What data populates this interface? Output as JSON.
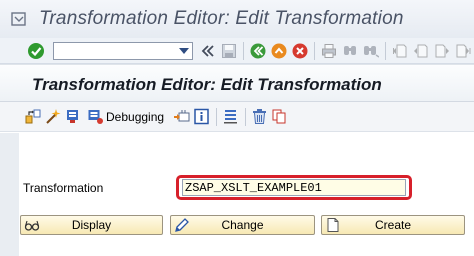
{
  "window": {
    "title": "Transformation Editor: Edit Transformation"
  },
  "toolbar": {
    "command_field_value": ""
  },
  "page": {
    "title": "Transformation Editor: Edit Transformation"
  },
  "app_toolbar": {
    "debugging_label": "Debugging"
  },
  "form": {
    "transformation_label": "Transformation",
    "transformation_value": "ZSAP_XSLT_EXAMPLE01",
    "highlight_color": "#d7202a"
  },
  "buttons": {
    "display": "Display",
    "change": "Change",
    "create": "Create"
  },
  "icons": {
    "title": "menu-icon",
    "standard_toolbar": [
      "enter-icon",
      "dropdown-icon",
      "collapse-icon",
      "save-icon",
      "back-icon",
      "exit-icon",
      "cancel-icon",
      "print-icon",
      "find-icon",
      "find-next-icon",
      "first-page-icon",
      "previous-page-icon",
      "next-page-icon",
      "last-page-icon"
    ],
    "app_toolbar": [
      "other-object-icon",
      "check-icon",
      "activate-icon",
      "debugging-icon",
      "where-used-icon",
      "info-icon",
      "stack-icon",
      "delete-icon",
      "copy-icon"
    ]
  }
}
